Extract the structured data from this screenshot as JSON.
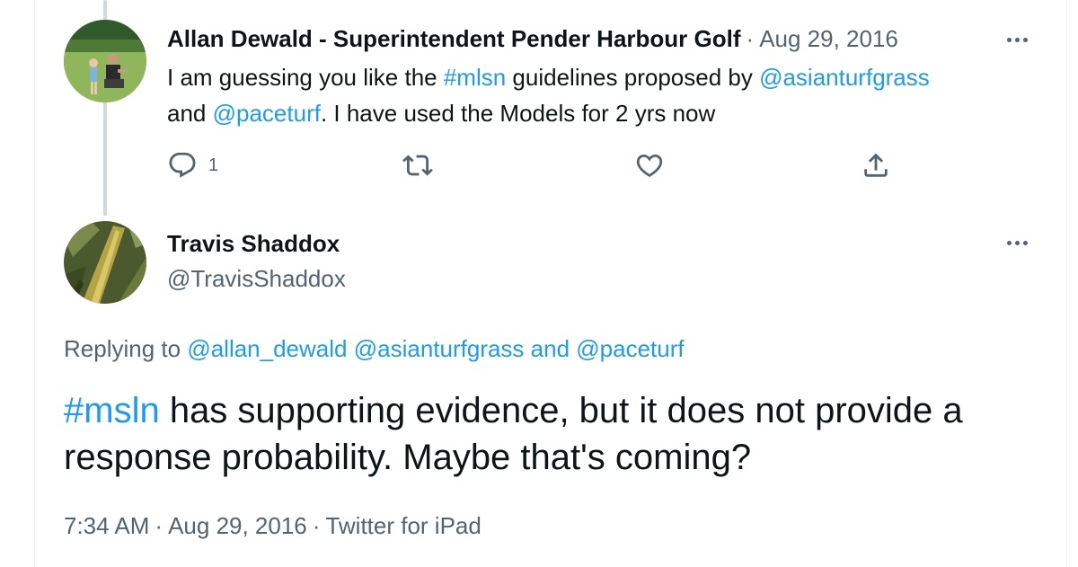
{
  "parent_tweet": {
    "author_name": "Allan Dewald - Superintendent Pender Harbour Golf",
    "separator": "·",
    "date": "Aug 29, 2016",
    "text_parts": [
      {
        "text": "I am guessing you like the ",
        "type": "text"
      },
      {
        "text": "#mlsn",
        "type": "link"
      },
      {
        "text": " guidelines proposed by ",
        "type": "text"
      },
      {
        "text": "@asianturfgrass",
        "type": "link"
      },
      {
        "text": " and ",
        "type": "text"
      },
      {
        "text": "@paceturf",
        "type": "link"
      },
      {
        "text": ". I have used the Models for 2 yrs now",
        "type": "text"
      }
    ],
    "reply_count": "1",
    "actions": {
      "reply_icon": "reply-icon",
      "retweet_icon": "retweet-icon",
      "like_icon": "heart-icon",
      "share_icon": "share-icon"
    }
  },
  "reply_tweet": {
    "author_name": "Travis Shaddox",
    "handle": "@TravisShaddox",
    "replying_prefix": "Replying to ",
    "replying_users": [
      {
        "text": "@allan_dewald",
        "type": "link"
      },
      {
        "text": " ",
        "type": "text"
      },
      {
        "text": "@asianturfgrass",
        "type": "link"
      },
      {
        "text": " and ",
        "type": "link"
      },
      {
        "text": "@paceturf",
        "type": "link"
      }
    ],
    "text_parts": [
      {
        "text": "#msln",
        "type": "link"
      },
      {
        "text": " has supporting evidence, but it does not provide a response probability. Maybe that's coming?",
        "type": "text"
      }
    ],
    "time": "7:34 AM",
    "date": "Aug 29, 2016",
    "source": "Twitter for iPad",
    "separator": "·"
  },
  "colors": {
    "link": "#1d9bf0",
    "muted": "#536471",
    "text": "#0f1419",
    "thread_line": "#cfd9de"
  }
}
